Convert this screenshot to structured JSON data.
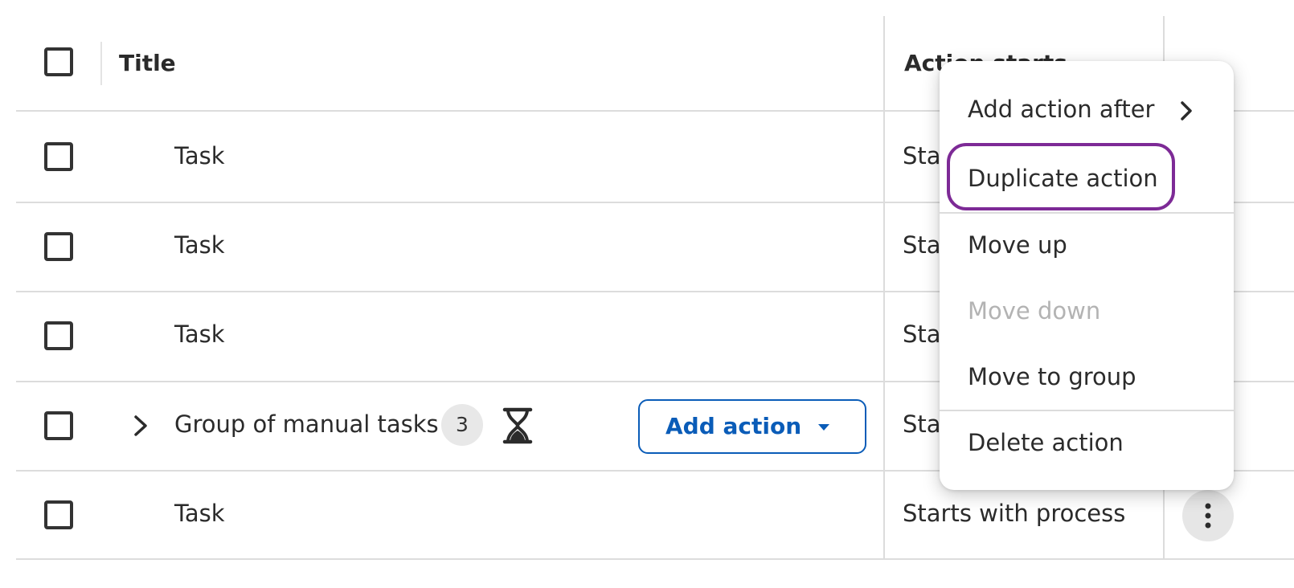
{
  "table": {
    "columns": {
      "title": "Title",
      "action_starts": "Action starts"
    },
    "rows": [
      {
        "title": "Task",
        "action_starts": "Starts with process"
      },
      {
        "title": "Task",
        "action_starts": "Starts with process"
      },
      {
        "title": "Task",
        "action_starts": "Starts with process"
      },
      {
        "title": "Group of manual tasks",
        "count": "3",
        "action_starts": "Starts with process",
        "add_action_label": "Add action"
      },
      {
        "title": "Task",
        "action_starts": "Starts with process"
      }
    ]
  },
  "context_menu": {
    "items": [
      {
        "label": "Add action after"
      },
      {
        "label": "Duplicate action",
        "highlighted": true
      },
      {
        "label": "Move up"
      },
      {
        "label": "Move down",
        "disabled": true
      },
      {
        "label": "Move to group"
      },
      {
        "label": "Delete action"
      }
    ]
  },
  "colors": {
    "primary_blue": "#0a5cb8",
    "highlight_purple": "#7d2a96",
    "disabled_text": "#b3b3b3"
  }
}
